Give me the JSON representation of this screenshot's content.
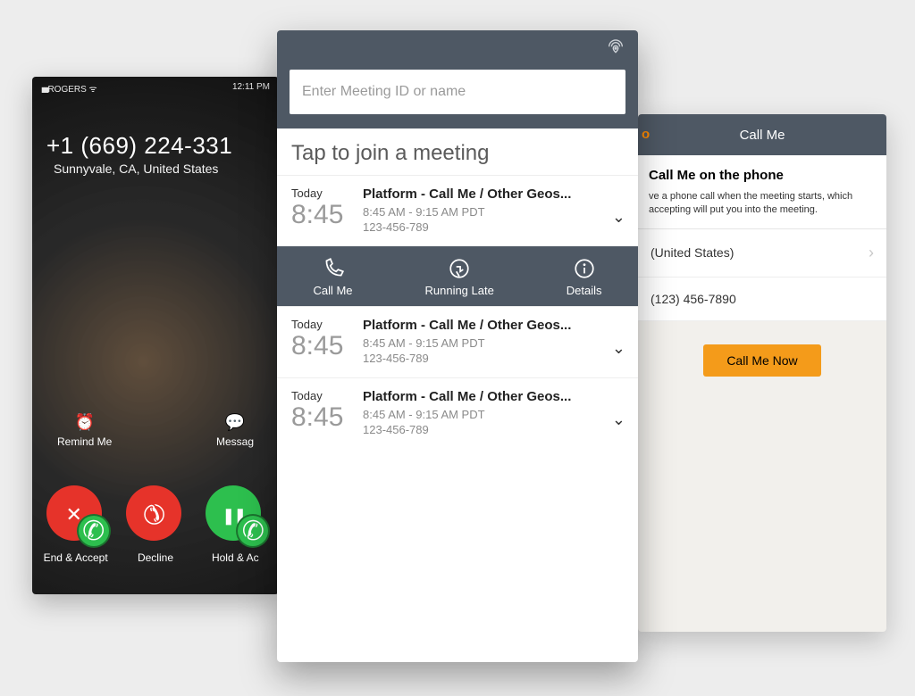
{
  "call": {
    "carrier": "ROGERS",
    "clock": "12:11 PM",
    "number": "+1 (669) 224-331",
    "location": "Sunnyvale, CA, United States",
    "remind_label": "Remind Me",
    "message_label": "Messag",
    "btn_end_accept": "End & Accept",
    "btn_decline": "Decline",
    "btn_hold_accept": "Hold & Ac"
  },
  "meet": {
    "search_placeholder": "Enter Meeting ID or name",
    "tap_title": "Tap to join a meeting",
    "actions": {
      "call_me": "Call Me",
      "running_late": "Running Late",
      "details": "Details"
    },
    "items": [
      {
        "day": "Today",
        "time": "8:45",
        "name": "Platform - Call Me / Other Geos...",
        "range": "8:45 AM - 9:15 AM PDT",
        "id": "123-456-789"
      },
      {
        "day": "Today",
        "time": "8:45",
        "name": "Platform - Call Me / Other Geos...",
        "range": "8:45 AM - 9:15 AM PDT",
        "id": "123-456-789"
      },
      {
        "day": "Today",
        "time": "8:45",
        "name": "Platform - Call Me / Other Geos...",
        "range": "8:45 AM - 9:15 AM PDT",
        "id": "123-456-789"
      }
    ]
  },
  "settings": {
    "header": "Call Me",
    "badge": "o",
    "card_title": "Call Me on the phone",
    "card_desc_1": "ve a phone call when the meeting starts, which",
    "card_desc_2": "accepting will put you into the meeting.",
    "country": "(United States)",
    "phone": "(123) 456-7890",
    "cta": "Call Me Now"
  }
}
